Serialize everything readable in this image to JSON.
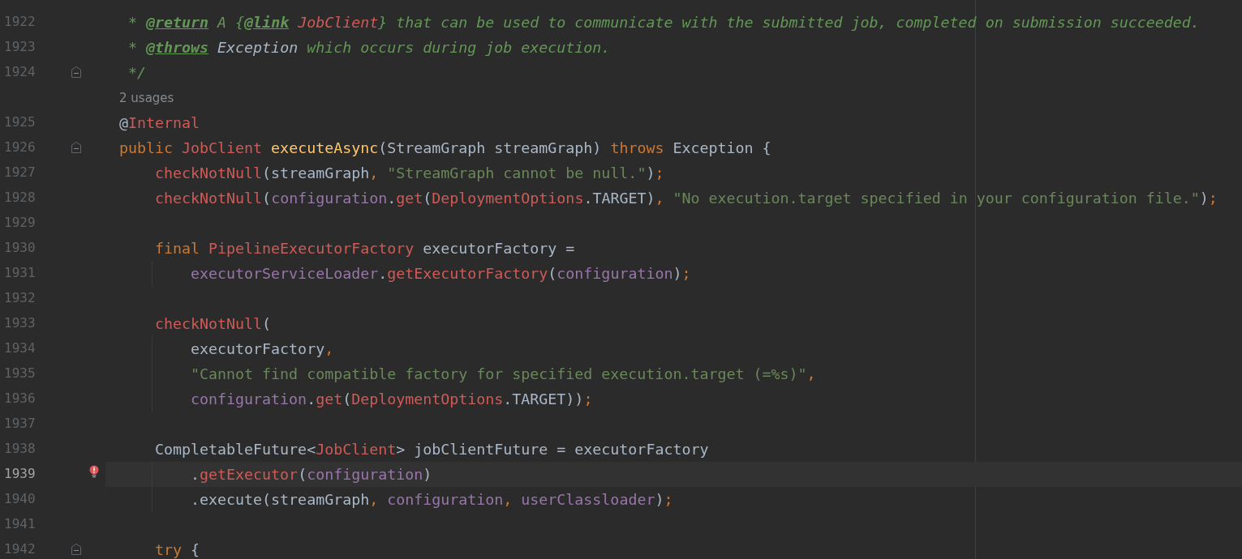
{
  "editor": {
    "lines": [
      {
        "kind": "code",
        "number": "1922",
        "fold": false,
        "current": false,
        "error": false,
        "guide": false,
        "tokens": [
          {
            "kind": "comment",
            "s": " * "
          },
          {
            "kind": "tag",
            "s": "@return"
          },
          {
            "kind": "comment",
            "s": " A {"
          },
          {
            "kind": "tag",
            "s": "@link"
          },
          {
            "kind": "docclass",
            "s": " JobClient"
          },
          {
            "kind": "comment",
            "s": "} that can be used to communicate with the submitted job, completed on submission succeeded."
          }
        ]
      },
      {
        "kind": "code",
        "number": "1923",
        "fold": false,
        "current": false,
        "error": false,
        "guide": false,
        "tokens": [
          {
            "kind": "comment",
            "s": " * "
          },
          {
            "kind": "tag",
            "s": "@throws"
          },
          {
            "kind": "docref",
            "s": " Exception"
          },
          {
            "kind": "comment",
            "s": " which occurs during job execution."
          }
        ]
      },
      {
        "kind": "code",
        "number": "1924",
        "fold": true,
        "current": false,
        "error": false,
        "guide": false,
        "tokens": [
          {
            "kind": "comment",
            "s": " */"
          }
        ]
      },
      {
        "kind": "hint",
        "text": "2 usages"
      },
      {
        "kind": "code",
        "number": "1925",
        "fold": false,
        "current": false,
        "error": false,
        "guide": false,
        "tokens": [
          {
            "kind": "plain",
            "s": "@"
          },
          {
            "kind": "cls",
            "s": "Internal"
          }
        ]
      },
      {
        "kind": "code",
        "number": "1926",
        "fold": true,
        "current": false,
        "error": false,
        "guide": false,
        "tokens": [
          {
            "kind": "kw",
            "s": "public"
          },
          {
            "kind": "cls",
            "s": " JobClient"
          },
          {
            "kind": "decl",
            "s": " executeAsync"
          },
          {
            "kind": "plain",
            "s": "(StreamGraph streamGraph) "
          },
          {
            "kind": "kw",
            "s": "throws"
          },
          {
            "kind": "plain",
            "s": " Exception {"
          }
        ]
      },
      {
        "kind": "code",
        "number": "1927",
        "fold": false,
        "current": false,
        "error": false,
        "guide": false,
        "tokens": [
          {
            "kind": "call",
            "s": "    checkNotNull"
          },
          {
            "kind": "plain",
            "s": "(streamGraph"
          },
          {
            "kind": "punct",
            "s": ", "
          },
          {
            "kind": "str",
            "s": "\"StreamGraph cannot be null.\""
          },
          {
            "kind": "plain",
            "s": ")"
          },
          {
            "kind": "punct",
            "s": ";"
          }
        ]
      },
      {
        "kind": "code",
        "number": "1928",
        "fold": false,
        "current": false,
        "error": false,
        "guide": false,
        "tokens": [
          {
            "kind": "call",
            "s": "    checkNotNull"
          },
          {
            "kind": "plain",
            "s": "("
          },
          {
            "kind": "field",
            "s": "configuration"
          },
          {
            "kind": "plain",
            "s": "."
          },
          {
            "kind": "call",
            "s": "get"
          },
          {
            "kind": "plain",
            "s": "("
          },
          {
            "kind": "cls",
            "s": "DeploymentOptions"
          },
          {
            "kind": "plain",
            "s": ".TARGET)"
          },
          {
            "kind": "punct",
            "s": ", "
          },
          {
            "kind": "str",
            "s": "\"No execution.target specified in your configuration file.\""
          },
          {
            "kind": "plain",
            "s": ")"
          },
          {
            "kind": "punct",
            "s": ";"
          }
        ]
      },
      {
        "kind": "code",
        "number": "1929",
        "fold": false,
        "current": false,
        "error": false,
        "guide": false
      },
      {
        "kind": "code",
        "number": "1930",
        "fold": false,
        "current": false,
        "error": false,
        "guide": false,
        "tokens": [
          {
            "kind": "kw",
            "s": "    final"
          },
          {
            "kind": "cls",
            "s": " PipelineExecutorFactory"
          },
          {
            "kind": "plain",
            "s": " executorFactory ="
          }
        ]
      },
      {
        "kind": "code",
        "number": "1931",
        "fold": false,
        "current": false,
        "error": false,
        "guide": true,
        "tokens": [
          {
            "kind": "field",
            "s": "        executorServiceLoader"
          },
          {
            "kind": "plain",
            "s": "."
          },
          {
            "kind": "call",
            "s": "getExecutorFactory"
          },
          {
            "kind": "plain",
            "s": "("
          },
          {
            "kind": "field",
            "s": "configuration"
          },
          {
            "kind": "plain",
            "s": ")"
          },
          {
            "kind": "punct",
            "s": ";"
          }
        ]
      },
      {
        "kind": "code",
        "number": "1932",
        "fold": false,
        "current": false,
        "error": false,
        "guide": false
      },
      {
        "kind": "code",
        "number": "1933",
        "fold": false,
        "current": false,
        "error": false,
        "guide": false,
        "tokens": [
          {
            "kind": "call",
            "s": "    checkNotNull"
          },
          {
            "kind": "plain",
            "s": "("
          }
        ]
      },
      {
        "kind": "code",
        "number": "1934",
        "fold": false,
        "current": false,
        "error": false,
        "guide": true,
        "tokens": [
          {
            "kind": "plain",
            "s": "        executorFactory"
          },
          {
            "kind": "punct",
            "s": ","
          }
        ]
      },
      {
        "kind": "code",
        "number": "1935",
        "fold": false,
        "current": false,
        "error": false,
        "guide": true,
        "tokens": [
          {
            "kind": "str",
            "s": "        \"Cannot find compatible factory for specified execution.target (=%s)\""
          },
          {
            "kind": "punct",
            "s": ","
          }
        ]
      },
      {
        "kind": "code",
        "number": "1936",
        "fold": false,
        "current": false,
        "error": false,
        "guide": true,
        "tokens": [
          {
            "kind": "field",
            "s": "        configuration"
          },
          {
            "kind": "plain",
            "s": "."
          },
          {
            "kind": "call",
            "s": "get"
          },
          {
            "kind": "plain",
            "s": "("
          },
          {
            "kind": "cls",
            "s": "DeploymentOptions"
          },
          {
            "kind": "plain",
            "s": ".TARGET))"
          },
          {
            "kind": "punct",
            "s": ";"
          }
        ]
      },
      {
        "kind": "code",
        "number": "1937",
        "fold": false,
        "current": false,
        "error": false,
        "guide": false
      },
      {
        "kind": "code",
        "number": "1938",
        "fold": false,
        "current": false,
        "error": false,
        "guide": false,
        "tokens": [
          {
            "kind": "plain",
            "s": "    CompletableFuture<"
          },
          {
            "kind": "cls",
            "s": "JobClient"
          },
          {
            "kind": "plain",
            "s": "> jobClientFuture = executorFactory"
          }
        ]
      },
      {
        "kind": "code",
        "number": "1939",
        "fold": false,
        "current": true,
        "error": true,
        "guide": true,
        "tokens": [
          {
            "kind": "plain",
            "s": "        ."
          },
          {
            "kind": "call",
            "s": "getExecutor"
          },
          {
            "kind": "plain",
            "s": "("
          },
          {
            "kind": "field",
            "s": "configuration"
          },
          {
            "kind": "plain",
            "s": ")"
          }
        ]
      },
      {
        "kind": "code",
        "number": "1940",
        "fold": false,
        "current": false,
        "error": false,
        "guide": true,
        "tokens": [
          {
            "kind": "plain",
            "s": "        .execute(streamGraph"
          },
          {
            "kind": "punct",
            "s": ", "
          },
          {
            "kind": "field",
            "s": "configuration"
          },
          {
            "kind": "punct",
            "s": ", "
          },
          {
            "kind": "field",
            "s": "userClassloader"
          },
          {
            "kind": "plain",
            "s": ")"
          },
          {
            "kind": "punct",
            "s": ";"
          }
        ]
      },
      {
        "kind": "code",
        "number": "1941",
        "fold": false,
        "current": false,
        "error": false,
        "guide": false
      },
      {
        "kind": "code",
        "number": "1942",
        "fold": true,
        "current": false,
        "error": false,
        "guide": false,
        "tokens": [
          {
            "kind": "kw",
            "s": "    try"
          },
          {
            "kind": "plain",
            "s": " {"
          }
        ]
      }
    ]
  }
}
